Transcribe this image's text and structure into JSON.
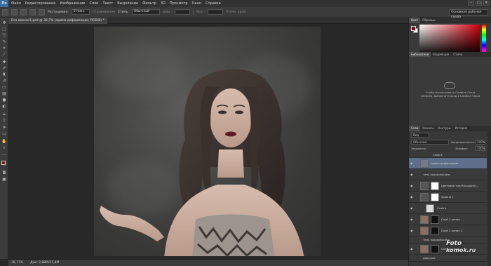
{
  "app": {
    "logo": "Ps"
  },
  "menu": [
    "Файл",
    "Редактирование",
    "Изображение",
    "Слои",
    "Текст",
    "Выделение",
    "Фильтр",
    "3D",
    "Просмотр",
    "Окно",
    "Справка"
  ],
  "window_controls": [
    "–",
    "□",
    "✕"
  ],
  "options": {
    "feather_label": "Растушевка:",
    "feather_value": "0 пикс.",
    "antialias_label": "Сглаживание",
    "style_label": "Стиль:",
    "style_value": "Обычный",
    "width_label": "Шир.:",
    "height_label": "Выс.:",
    "refine_label": "Уточн. край...",
    "workspace": "Основная рабочая среда"
  },
  "document": {
    "tab": "Без имени-1.psd @ 36,7% (прием деформации, RGB/8) *"
  },
  "status": {
    "zoom": "36,77%",
    "doc": "Док: 2,88M/37,8M"
  },
  "panels": {
    "color_tabs": [
      "Цвет",
      "Образцы"
    ],
    "library_tabs": [
      "Библиотеки",
      "Коррекция",
      "Стили"
    ],
    "library_msg": "Чтобы использовать Creative Cloud Libraries, выполните вход в Creative Cloud",
    "layers_tabs": [
      "Слои",
      "Каналы",
      "Контуры",
      "История"
    ],
    "kind": "Вид",
    "blend": "Обычные",
    "opacity_label": "Непрозрачность:",
    "opacity_value": "100%",
    "lock_label": "Закрепить:",
    "fill_label": "Заливка:",
    "fill_value": "100%"
  },
  "layers": [
    {
      "name": "Слой 6"
    },
    {
      "name": "прием деформации",
      "selected": true
    },
    {
      "name": "тень под волосами"
    },
    {
      "name": "Цветовой тон/Насыщенн..."
    },
    {
      "name": "Уровни 1"
    },
    {
      "name": "Слой 4"
    },
    {
      "name": "Слой 2 копия..."
    },
    {
      "name": "Слой 2 копия 2"
    },
    {
      "name": "Тень под волосами"
    },
    {
      "name": "Слой 2 копия"
    },
    {
      "name": "девушка"
    }
  ],
  "watermark": {
    "line1": "Foto",
    "line2": "komok.ru"
  }
}
